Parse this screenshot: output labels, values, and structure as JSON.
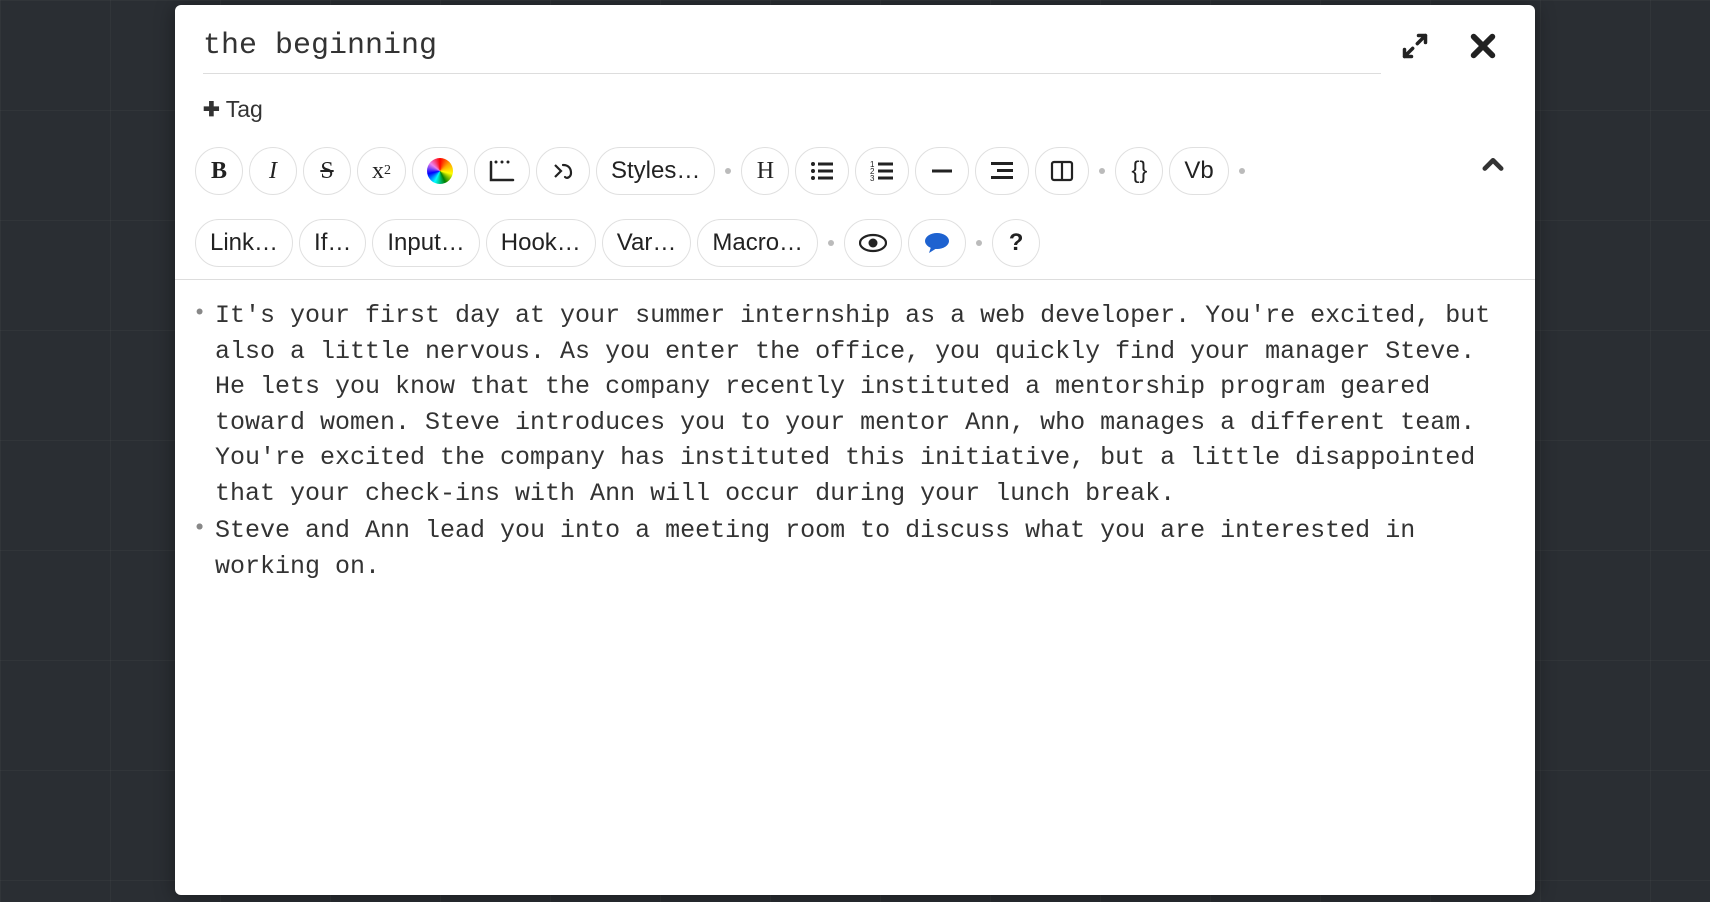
{
  "title": "the beginning",
  "tag_label": "Tag",
  "toolbar": {
    "styles_label": "Styles…",
    "link_label": "Link…",
    "if_label": "If…",
    "input_label": "Input…",
    "hook_label": "Hook…",
    "var_label": "Var…",
    "macro_label": "Macro…",
    "vb_label": "Vb",
    "help_label": "?"
  },
  "content": {
    "lines": [
      "It's your first day at your summer internship as a web developer. You're excited, but also a little nervous. As you enter the office, you quickly find your manager Steve. He lets you know that the company recently instituted a mentorship program geared toward women. Steve introduces you to your mentor Ann, who manages a different team. You're excited the company has instituted this initiative, but a little disappointed that your check-ins with Ann will occur during your lunch break.",
      "",
      "Steve and Ann lead you into a meeting room to discuss what you are interested in working on."
    ]
  }
}
